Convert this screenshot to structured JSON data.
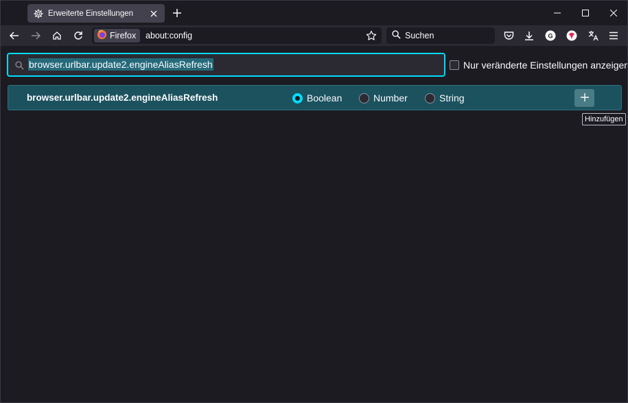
{
  "tab": {
    "title": "Erweiterte Einstellungen",
    "icon": "gear-icon"
  },
  "navbar": {
    "identity_label": "Firefox",
    "url": "about:config",
    "search_placeholder": "Suchen"
  },
  "config": {
    "search_value": "browser.urlbar.update2.engineAliasRefresh",
    "modified_only_label": "Nur veränderte Einstellungen anzeigen",
    "pref_name": "browser.urlbar.update2.engineAliasRefresh",
    "types": [
      "Boolean",
      "Number",
      "String"
    ],
    "selected_type": "Boolean",
    "add_tooltip": "Hinzufügen"
  },
  "colors": {
    "accent": "#00ddff",
    "row_bg": "#1b525e",
    "background": "#1c1b22",
    "toolbar": "#2b2a33"
  }
}
